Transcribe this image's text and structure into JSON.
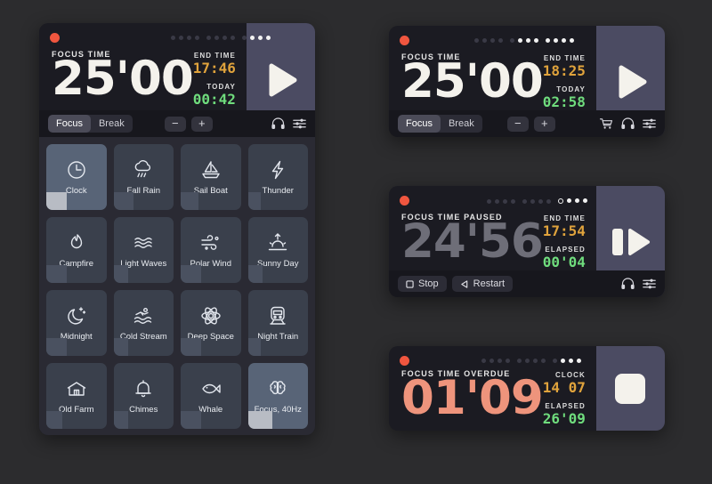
{
  "app": {
    "name": "Focus Timer",
    "background": "#2c2c2e",
    "accent_play_panel": "#4b4b62"
  },
  "colors": {
    "amber": "#e0a33c",
    "green": "#6fdc7d",
    "overdue": "#ee947c",
    "paused_digits": "#6e6e78",
    "window_bg": "#1b1b22",
    "tile_bg": "#3a404c",
    "tile_selected": "#586477"
  },
  "windows": [
    {
      "id": "main-window",
      "state": "ready",
      "traffic_light": "close-red",
      "progress_dots": [
        {
          "filled": false
        },
        {
          "filled": false
        },
        {
          "filled": false
        },
        {
          "filled": false
        },
        {
          "filled": false
        },
        {
          "filled": false
        },
        {
          "filled": false
        },
        {
          "filled": false
        },
        {
          "filled": false
        },
        {
          "filled": true
        },
        {
          "filled": true
        },
        {
          "filled": true
        }
      ],
      "status_label": "FOCUS TIME",
      "time": "25'00",
      "stats": [
        {
          "label": "END TIME",
          "value": "17:46",
          "color": "amber"
        },
        {
          "label": "TODAY",
          "value": "00:42",
          "color": "green"
        }
      ],
      "mode_tabs": [
        {
          "label": "Focus",
          "active": true
        },
        {
          "label": "Break",
          "active": false
        }
      ],
      "stepper": {
        "minus": "−",
        "plus": "+"
      },
      "footer_icons": [
        "headphones-icon",
        "equalizer-icon"
      ],
      "transport_icon": "play-icon",
      "sounds": [
        {
          "name": "Clock",
          "icon": "clock-icon",
          "selected": true,
          "volume": 34
        },
        {
          "name": "Fall Rain",
          "icon": "rain-cloud-icon",
          "selected": false,
          "volume": 34
        },
        {
          "name": "Sail Boat",
          "icon": "sailboat-icon",
          "selected": false,
          "volume": 30
        },
        {
          "name": "Thunder",
          "icon": "lightning-icon",
          "selected": false,
          "volume": 22
        },
        {
          "name": "Campfire",
          "icon": "campfire-icon",
          "selected": false,
          "volume": 34
        },
        {
          "name": "Light Waves",
          "icon": "waves-icon",
          "selected": false,
          "volume": 24
        },
        {
          "name": "Polar Wind",
          "icon": "wind-icon",
          "selected": false,
          "volume": 34
        },
        {
          "name": "Sunny Day",
          "icon": "sunrise-icon",
          "selected": false,
          "volume": 24
        },
        {
          "name": "Midnight",
          "icon": "moon-stars-icon",
          "selected": false,
          "volume": 34
        },
        {
          "name": "Cold Stream",
          "icon": "swimmer-icon",
          "selected": false,
          "volume": 24
        },
        {
          "name": "Deep Space",
          "icon": "atom-icon",
          "selected": false,
          "volume": 34
        },
        {
          "name": "Night Train",
          "icon": "train-icon",
          "selected": false,
          "volume": 22
        },
        {
          "name": "Old Farm",
          "icon": "barn-icon",
          "selected": false,
          "volume": 26
        },
        {
          "name": "Chimes",
          "icon": "bell-icon",
          "selected": false,
          "volume": 24
        },
        {
          "name": "Whale",
          "icon": "fish-icon",
          "selected": false,
          "volume": 34
        },
        {
          "name": "Focus, 40Hz",
          "icon": "brain-icon",
          "selected": true,
          "volume": 40
        }
      ]
    },
    {
      "id": "compact-window",
      "state": "ready",
      "traffic_light": "close-red",
      "progress_dots": [
        {
          "filled": false
        },
        {
          "filled": false
        },
        {
          "filled": false
        },
        {
          "filled": false
        },
        {
          "filled": false
        },
        {
          "filled": true
        },
        {
          "filled": true
        },
        {
          "filled": true
        },
        {
          "filled": true
        },
        {
          "filled": true
        },
        {
          "filled": true
        },
        {
          "filled": true
        }
      ],
      "status_label": "FOCUS TIME",
      "time": "25'00",
      "stats": [
        {
          "label": "END TIME",
          "value": "18:25",
          "color": "amber"
        },
        {
          "label": "TODAY",
          "value": "02:58",
          "color": "green"
        }
      ],
      "mode_tabs": [
        {
          "label": "Focus",
          "active": true
        },
        {
          "label": "Break",
          "active": false
        }
      ],
      "stepper": {
        "minus": "−",
        "plus": "+"
      },
      "footer_icons": [
        "cart-icon",
        "headphones-icon",
        "equalizer-icon"
      ],
      "transport_icon": "play-icon"
    },
    {
      "id": "paused-window",
      "state": "paused",
      "traffic_light": "close-red",
      "progress_dots": [
        {
          "filled": false
        },
        {
          "filled": false
        },
        {
          "filled": false
        },
        {
          "filled": false
        },
        {
          "filled": false
        },
        {
          "filled": false
        },
        {
          "filled": false
        },
        {
          "filled": false
        },
        {
          "ring": true
        },
        {
          "filled": true
        },
        {
          "filled": true
        },
        {
          "filled": true
        }
      ],
      "status_label": "FOCUS TIME PAUSED",
      "time": "24'56",
      "stats": [
        {
          "label": "END TIME",
          "value": "17:54",
          "color": "amber"
        },
        {
          "label": "ELAPSED",
          "value": "00'04",
          "color": "green"
        }
      ],
      "buttons": [
        {
          "label": "Stop",
          "icon": "stop-square-icon"
        },
        {
          "label": "Restart",
          "icon": "restart-triangle-icon"
        }
      ],
      "footer_icons": [
        "headphones-icon",
        "equalizer-icon"
      ],
      "transport_icon": "pause-play-icon"
    },
    {
      "id": "overdue-window",
      "state": "overdue",
      "traffic_light": "close-red",
      "progress_dots": [
        {
          "filled": false
        },
        {
          "filled": false
        },
        {
          "filled": false
        },
        {
          "filled": false
        },
        {
          "filled": false
        },
        {
          "filled": false
        },
        {
          "filled": false
        },
        {
          "filled": false
        },
        {
          "filled": false
        },
        {
          "filled": true
        },
        {
          "filled": true
        },
        {
          "filled": true
        }
      ],
      "status_label": "FOCUS TIME OVERDUE",
      "time": "01'09",
      "stats": [
        {
          "label": "CLOCK",
          "value": "14 07",
          "color": "amber"
        },
        {
          "label": "ELAPSED",
          "value": "26'09",
          "color": "green"
        }
      ],
      "transport_icon": "stop-rounded-icon"
    }
  ]
}
